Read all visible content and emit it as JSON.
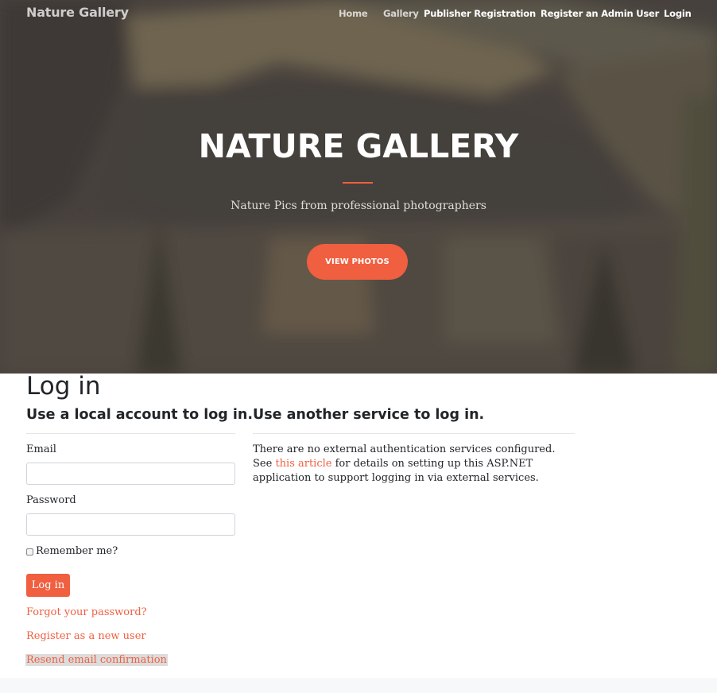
{
  "navbar": {
    "brand": "Nature Gallery",
    "items": [
      {
        "label": "Home"
      },
      {
        "label": "Gallery"
      },
      {
        "label": "Publisher Registration"
      },
      {
        "label": "Register an Admin User"
      },
      {
        "label": "Login"
      }
    ]
  },
  "hero": {
    "title": "NATURE GALLERY",
    "subtitle": "Nature Pics from professional photographers",
    "button_label": "VIEW PHOTOS"
  },
  "login": {
    "heading": "Log in",
    "local_heading": "Use a local account to log in.",
    "email_label": "Email",
    "email_value": "",
    "password_label": "Password",
    "password_value": "",
    "remember_label": "Remember me?",
    "remember_checked": false,
    "submit_label": "Log in",
    "forgot_link": "Forgot your password?",
    "register_link": "Register as a new user",
    "resend_link": "Resend email confirmation"
  },
  "external": {
    "heading": "Use another service to log in.",
    "text_before": "There are no external authentication services configured. See ",
    "link_text": "this article",
    "text_after": " for details on setting up this ASP.NET application to support logging in via external services."
  },
  "colors": {
    "accent": "#f05f40",
    "text": "#212529"
  }
}
